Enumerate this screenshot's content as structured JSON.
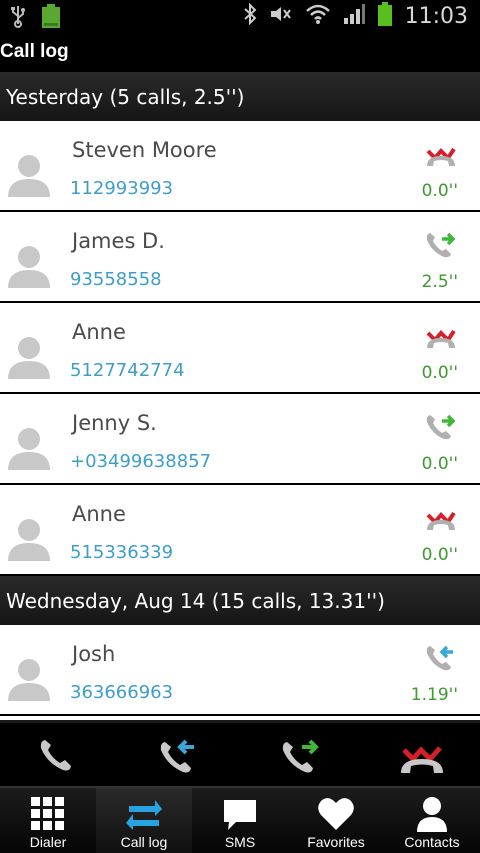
{
  "status_bar": {
    "time": "11:03",
    "icons": [
      "usb-icon",
      "battery-small-icon",
      "bluetooth-icon",
      "mute-icon",
      "wifi-icon",
      "signal-icon",
      "battery-icon"
    ]
  },
  "app": {
    "title": "Call log"
  },
  "sections": [
    {
      "header": "Yesterday (5 calls, 2.5'')",
      "calls": [
        {
          "name": "Steven Moore",
          "number": "112993993",
          "type": "missed",
          "duration": "0.0''"
        },
        {
          "name": "James D.",
          "number": "93558558",
          "type": "outgoing",
          "duration": "2.5''"
        },
        {
          "name": "Anne",
          "number": "5127742774",
          "type": "missed",
          "duration": "0.0''"
        },
        {
          "name": "Jenny S.",
          "number": "+03499638857",
          "type": "outgoing",
          "duration": "0.0''"
        },
        {
          "name": "Anne",
          "number": "515336339",
          "type": "missed",
          "duration": "0.0''"
        }
      ]
    },
    {
      "header": "Wednesday, Aug 14 (15 calls, 13.31'')",
      "calls": [
        {
          "name": "Josh",
          "number": "363666963",
          "type": "incoming",
          "duration": "1.19''"
        }
      ]
    }
  ],
  "action_bar": {
    "buttons": [
      "all-calls-icon",
      "incoming-calls-icon",
      "outgoing-calls-icon",
      "missed-calls-icon"
    ]
  },
  "tabs": [
    {
      "label": "Dialer",
      "icon": "dialpad-icon",
      "active": false
    },
    {
      "label": "Call log",
      "icon": "call-log-icon",
      "active": true
    },
    {
      "label": "SMS",
      "icon": "sms-icon",
      "active": false
    },
    {
      "label": "Favorites",
      "icon": "heart-icon",
      "active": false
    },
    {
      "label": "Contacts",
      "icon": "contact-icon",
      "active": false
    }
  ],
  "colors": {
    "number_blue": "#3d9ec9",
    "duration_green": "#3c9a2e",
    "missed_red": "#d4202a",
    "outgoing_green": "#3fb83a",
    "incoming_blue": "#3aa7d8",
    "active_tab_blue": "#29a3e0"
  }
}
